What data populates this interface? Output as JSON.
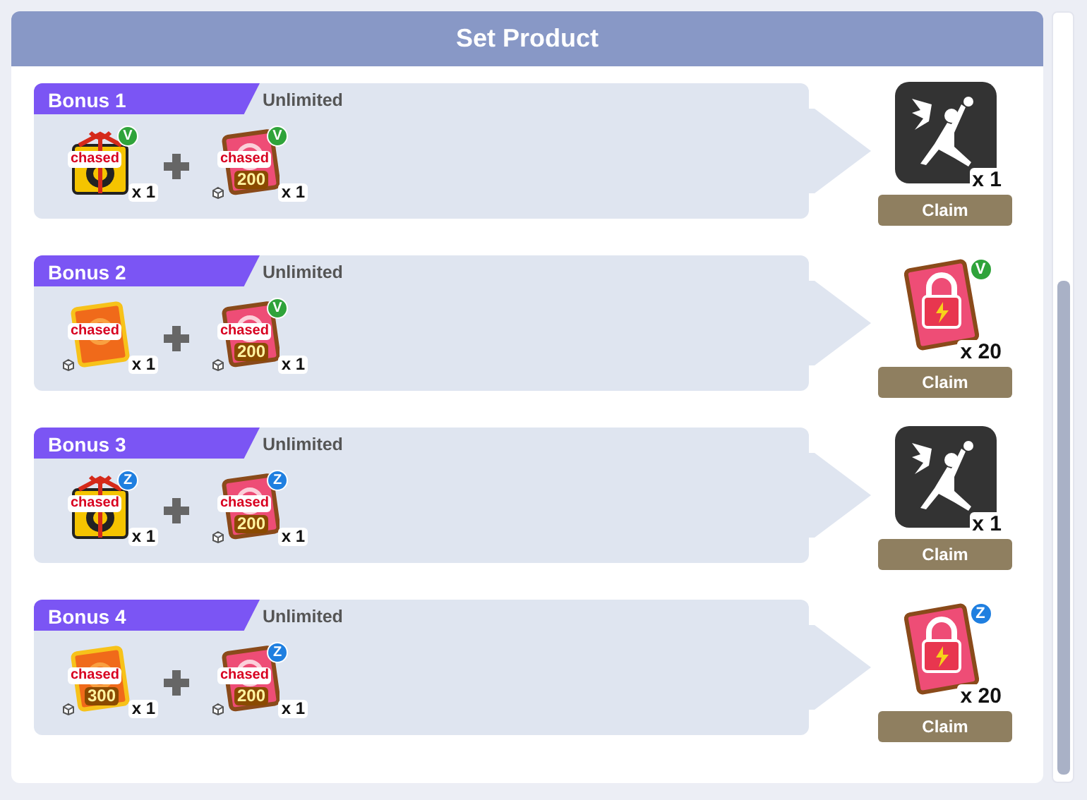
{
  "title": "Set Product",
  "bonuses": [
    {
      "label": "Bonus 1",
      "limit": "Unlimited",
      "items": [
        {
          "kind": "gift",
          "tag": "chased",
          "badge": {
            "letter": "V",
            "color": "#2fa33a"
          },
          "count": "x 1"
        },
        {
          "kind": "card",
          "tag": "chased",
          "number": "200",
          "badge": {
            "letter": "V",
            "color": "#2fa33a"
          },
          "count": "x 1"
        }
      ],
      "reward": {
        "kind": "silhouette",
        "count": "x 1"
      },
      "claim": {
        "label": "Claim",
        "disabled": true
      }
    },
    {
      "label": "Bonus 2",
      "limit": "Unlimited",
      "items": [
        {
          "kind": "coupon",
          "tag": "chased",
          "count": "x 1"
        },
        {
          "kind": "card",
          "tag": "chased",
          "number": "200",
          "badge": {
            "letter": "V",
            "color": "#2fa33a"
          },
          "count": "x 1"
        }
      ],
      "reward": {
        "kind": "lock-card",
        "badge": {
          "letter": "V",
          "color": "#2fa33a"
        },
        "count": "x 20"
      },
      "claim": {
        "label": "Claim",
        "disabled": true
      }
    },
    {
      "label": "Bonus 3",
      "limit": "Unlimited",
      "items": [
        {
          "kind": "gift",
          "tag": "chased",
          "badge": {
            "letter": "Z",
            "color": "#1f7fe0"
          },
          "count": "x 1"
        },
        {
          "kind": "card",
          "tag": "chased",
          "number": "200",
          "badge": {
            "letter": "Z",
            "color": "#1f7fe0"
          },
          "count": "x 1"
        }
      ],
      "reward": {
        "kind": "silhouette",
        "count": "x 1"
      },
      "claim": {
        "label": "Claim",
        "disabled": true
      }
    },
    {
      "label": "Bonus 4",
      "limit": "Unlimited",
      "items": [
        {
          "kind": "coupon",
          "tag": "chased",
          "number": "300",
          "count": "x 1"
        },
        {
          "kind": "card",
          "tag": "chased",
          "number": "200",
          "badge": {
            "letter": "Z",
            "color": "#1f7fe0"
          },
          "count": "x 1"
        }
      ],
      "reward": {
        "kind": "lock-card",
        "badge": {
          "letter": "Z",
          "color": "#1f7fe0"
        },
        "count": "x 20"
      },
      "claim": {
        "label": "Claim",
        "disabled": true
      }
    }
  ]
}
